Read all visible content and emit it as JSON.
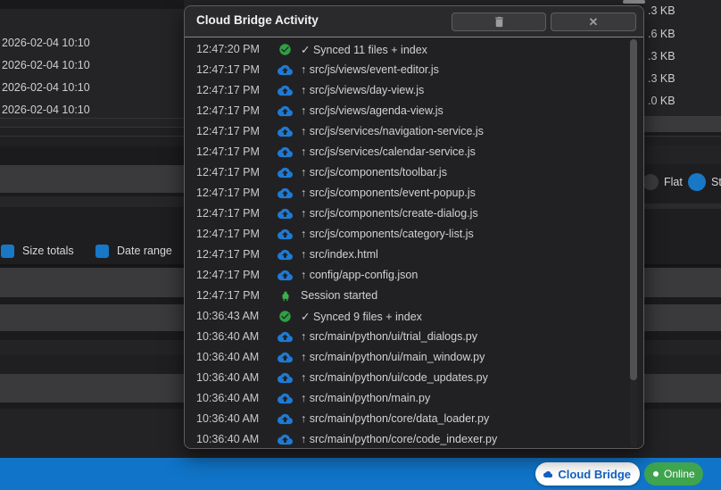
{
  "window": {
    "file_table": {
      "date_cells": [
        "2026-02-04 10:10",
        "2026-02-04 10:10",
        "2026-02-04 10:10",
        "2026-02-04 10:10"
      ],
      "size_cells": [
        ".3 KB",
        ".6 KB",
        ".3 KB",
        ".3 KB",
        ".0 KB"
      ]
    },
    "filter_toggles": [
      {
        "label": "Size totals",
        "checked": true
      },
      {
        "label": "Date range",
        "checked": true
      }
    ],
    "layout_options": [
      {
        "label": "Flat",
        "selected": false
      },
      {
        "label": "St",
        "selected": true
      }
    ]
  },
  "dialog": {
    "title": "Cloud Bridge Activity",
    "close_glyph": "✕",
    "log": [
      {
        "time": "12:47:20 PM",
        "icon": "success",
        "text": "✓ Synced 11 files + index"
      },
      {
        "time": "12:47:17 PM",
        "icon": "upload",
        "text": "↑ src/js/views/event-editor.js"
      },
      {
        "time": "12:47:17 PM",
        "icon": "upload",
        "text": "↑ src/js/views/day-view.js"
      },
      {
        "time": "12:47:17 PM",
        "icon": "upload",
        "text": "↑ src/js/views/agenda-view.js"
      },
      {
        "time": "12:47:17 PM",
        "icon": "upload",
        "text": "↑ src/js/services/navigation-service.js"
      },
      {
        "time": "12:47:17 PM",
        "icon": "upload",
        "text": "↑ src/js/services/calendar-service.js"
      },
      {
        "time": "12:47:17 PM",
        "icon": "upload",
        "text": "↑ src/js/components/toolbar.js"
      },
      {
        "time": "12:47:17 PM",
        "icon": "upload",
        "text": "↑ src/js/components/event-popup.js"
      },
      {
        "time": "12:47:17 PM",
        "icon": "upload",
        "text": "↑ src/js/components/create-dialog.js"
      },
      {
        "time": "12:47:17 PM",
        "icon": "upload",
        "text": "↑ src/js/components/category-list.js"
      },
      {
        "time": "12:47:17 PM",
        "icon": "upload",
        "text": "↑ src/index.html"
      },
      {
        "time": "12:47:17 PM",
        "icon": "upload",
        "text": "↑ config/app-config.json"
      },
      {
        "time": "12:47:17 PM",
        "icon": "plug",
        "text": "Session started"
      },
      {
        "time": "10:36:43 AM",
        "icon": "success",
        "text": "✓ Synced 9 files + index"
      },
      {
        "time": "10:36:40 AM",
        "icon": "upload",
        "text": "↑ src/main/python/ui/trial_dialogs.py"
      },
      {
        "time": "10:36:40 AM",
        "icon": "upload",
        "text": "↑ src/main/python/ui/main_window.py"
      },
      {
        "time": "10:36:40 AM",
        "icon": "upload",
        "text": "↑ src/main/python/ui/code_updates.py"
      },
      {
        "time": "10:36:40 AM",
        "icon": "upload",
        "text": "↑ src/main/python/main.py"
      },
      {
        "time": "10:36:40 AM",
        "icon": "upload",
        "text": "↑ src/main/python/core/data_loader.py"
      },
      {
        "time": "10:36:40 AM",
        "icon": "upload",
        "text": "↑ src/main/python/core/code_indexer.py"
      }
    ]
  },
  "status_bar": {
    "cloud_bridge_label": "Cloud Bridge",
    "online_label": "Online"
  },
  "colors": {
    "upload_blue": "#1f7ad4",
    "success_green": "#2ea043",
    "plug_green": "#3fae50",
    "checkbox_blue": "#1878c6",
    "statusbar_blue": "#1074c8",
    "online_green": "#3fa44e",
    "pill_text_blue": "#1263c4",
    "button_icon_gray": "#9d9da1"
  }
}
